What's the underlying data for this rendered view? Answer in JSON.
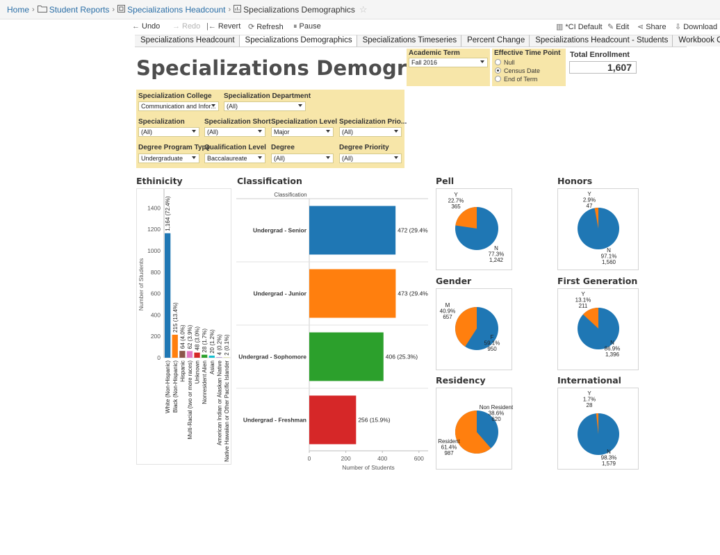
{
  "breadcrumb": {
    "home": "Home",
    "sep": "›",
    "reports": "Student Reports",
    "workbook": "Specializations Headcount",
    "current": "Specializations Demographics",
    "star": "☆"
  },
  "toolbar": {
    "undo": "Undo",
    "redo": "Redo",
    "revert": "Revert",
    "refresh": "Refresh",
    "pause": "Pause",
    "view": "*CI Default",
    "edit": "Edit",
    "share": "Share",
    "download": "Download"
  },
  "tabs": [
    "Specializations Headcount",
    "Specializations Demographics",
    "Specializations Timeseries",
    "Percent Change",
    "Specializations Headcount - Students",
    "Workbook Overview"
  ],
  "title": "Specializations Demographics",
  "academic_term": {
    "label": "Academic Term",
    "value": "Fall 2016"
  },
  "time_point": {
    "label": "Effective Time Point",
    "options": [
      "Null",
      "Census Date",
      "End of Term"
    ],
    "selected": "Census Date"
  },
  "total_enrollment": {
    "label": "Total Enrollment",
    "value": "1,607"
  },
  "filters": {
    "college": {
      "label": "Specialization College",
      "value": "Communication and Infor..."
    },
    "department": {
      "label": "Specialization Department",
      "value": "(All)"
    },
    "specialization": {
      "label": "Specialization",
      "value": "(All)"
    },
    "short": {
      "label": "Specialization Short",
      "value": "(All)"
    },
    "level": {
      "label": "Specialization Level",
      "value": "Major"
    },
    "priority": {
      "label": "Specialization Prio...",
      "value": "(All)"
    },
    "program_type": {
      "label": "Degree Program Type",
      "value": "Undergraduate"
    },
    "qualification": {
      "label": "Qualification Level",
      "value": "Baccalaureate"
    },
    "degree": {
      "label": "Degree",
      "value": "(All)"
    },
    "degree_priority": {
      "label": "Degree Priority",
      "value": "(All)"
    }
  },
  "sections": {
    "ethnicity": "Ethinicity",
    "classification": "Classification",
    "pell": "Pell",
    "honors": "Honors",
    "gender": "Gender",
    "first_gen": "First Generation",
    "residency": "Residency",
    "international": "International"
  },
  "chart_data": [
    {
      "type": "bar",
      "ylabel": "Number of Students",
      "ylim": [
        0,
        1500
      ],
      "yticks": [
        0,
        200,
        400,
        600,
        800,
        1000,
        1200,
        1400
      ],
      "categories": [
        "White (Non-Hispanic)",
        "Black (Non-Hispanic)",
        "Hispanic",
        "Multi-Racial (two or more races)",
        "Unknown",
        "Nonresident Alien",
        "Asian",
        "American Indian or Alaskan Native",
        "Native Hawaiian or Other Pacific Islander"
      ],
      "values": [
        1164,
        215,
        64,
        62,
        48,
        28,
        20,
        4,
        2
      ],
      "labels": [
        "1,164 (72.4%)",
        "215 (13.4%)",
        "64 (4.0%)",
        "62 (3.9%)",
        "48 (3.0%)",
        "28 (1.7%)",
        "20 (1.2%)",
        "4 (0.2%)",
        "2 (0.1%)"
      ],
      "colors": [
        "#1f77b4",
        "#ff7f0e",
        "#8c564b",
        "#e377c2",
        "#d62728",
        "#2ca02c",
        "#17becf",
        "#9467bd",
        "#bcbd22"
      ]
    },
    {
      "type": "bar",
      "orientation": "horizontal",
      "header": "Classification",
      "xlabel": "Number of Students",
      "xlim": [
        0,
        650
      ],
      "xticks": [
        0,
        200,
        400,
        600
      ],
      "categories": [
        "Undergrad - Senior",
        "Undergrad - Junior",
        "Undergrad - Sophomore",
        "Undergrad - Freshman"
      ],
      "values": [
        472,
        473,
        406,
        256
      ],
      "labels": [
        "472 (29.4%)",
        "473 (29.4%)",
        "406 (25.3%)",
        "256 (15.9%)"
      ],
      "colors": [
        "#1f77b4",
        "#ff7f0e",
        "#2ca02c",
        "#d62728"
      ]
    },
    {
      "type": "pie",
      "title": "Pell",
      "slices": [
        {
          "label": "Y",
          "pct": "22.7%",
          "count": "365",
          "value": 365,
          "color": "#ff7f0e"
        },
        {
          "label": "N",
          "pct": "77.3%",
          "count": "1,242",
          "value": 1242,
          "color": "#1f77b4"
        }
      ]
    },
    {
      "type": "pie",
      "title": "Honors",
      "slices": [
        {
          "label": "Y",
          "pct": "2.9%",
          "count": "47",
          "value": 47,
          "color": "#ff7f0e"
        },
        {
          "label": "N",
          "pct": "97.1%",
          "count": "1,560",
          "value": 1560,
          "color": "#1f77b4"
        }
      ]
    },
    {
      "type": "pie",
      "title": "Gender",
      "slices": [
        {
          "label": "M",
          "pct": "40.9%",
          "count": "657",
          "value": 657,
          "color": "#ff7f0e"
        },
        {
          "label": "F",
          "pct": "59.1%",
          "count": "950",
          "value": 950,
          "color": "#1f77b4"
        }
      ]
    },
    {
      "type": "pie",
      "title": "First Generation",
      "slices": [
        {
          "label": "Y",
          "pct": "13.1%",
          "count": "211",
          "value": 211,
          "color": "#ff7f0e"
        },
        {
          "label": "N",
          "pct": "86.9%",
          "count": "1,396",
          "value": 1396,
          "color": "#1f77b4"
        }
      ]
    },
    {
      "type": "pie",
      "title": "Residency",
      "slices": [
        {
          "label": "Resident",
          "pct": "61.4%",
          "count": "987",
          "value": 987,
          "color": "#ff7f0e"
        },
        {
          "label": "Non Resident",
          "pct": "38.6%",
          "count": "620",
          "value": 620,
          "color": "#1f77b4"
        }
      ]
    },
    {
      "type": "pie",
      "title": "International",
      "slices": [
        {
          "label": "Y",
          "pct": "1.7%",
          "count": "28",
          "value": 28,
          "color": "#ff7f0e"
        },
        {
          "label": "N",
          "pct": "98.3%",
          "count": "1,579",
          "value": 1579,
          "color": "#1f77b4"
        }
      ]
    }
  ]
}
